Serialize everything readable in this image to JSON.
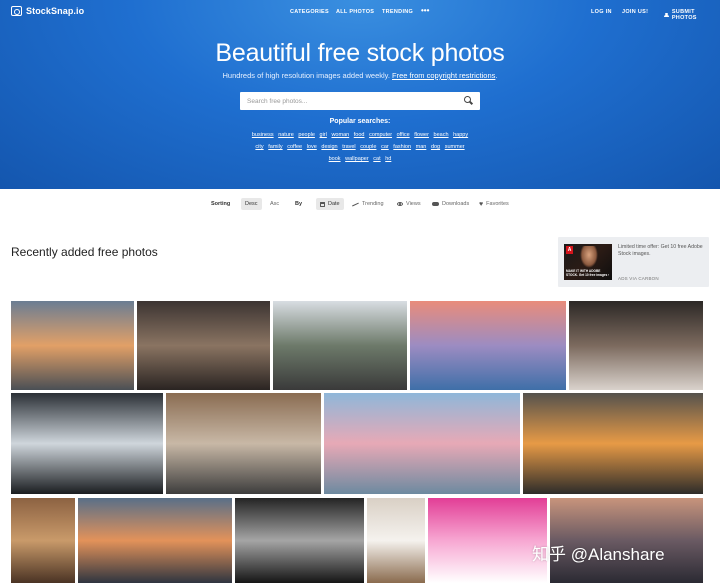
{
  "nav": {
    "logo": "StockSnap.io",
    "categories": "CATEGORIES",
    "all_photos": "ALL PHOTOS",
    "trending": "TRENDING",
    "more": "•••",
    "login": "LOG IN",
    "join": "JOIN US!",
    "submit": "SUBMIT PHOTOS"
  },
  "hero": {
    "title": "Beautiful free stock photos",
    "subtitle_prefix": "Hundreds of high resolution images added weekly. ",
    "subtitle_link": "Free from copyright restrictions",
    "subtitle_suffix": ".",
    "search_placeholder": "Search free photos...",
    "popular_title": "Popular searches:",
    "tags_row1": [
      "business",
      "nature",
      "people",
      "girl",
      "woman",
      "food",
      "computer",
      "office",
      "flower",
      "beach",
      "happy"
    ],
    "tags_row2": [
      "city",
      "family",
      "coffee",
      "love",
      "design",
      "travel",
      "couple",
      "car",
      "fashion",
      "man",
      "dog",
      "summer"
    ],
    "tags_row3": [
      "book",
      "wallpaper",
      "cat",
      "hd"
    ]
  },
  "sorting": {
    "label": "Sorting",
    "desc": "Desc",
    "asc": "Asc",
    "by_label": "By",
    "date": "Date",
    "trending": "Trending",
    "views": "Views",
    "downloads": "Downloads",
    "favorites": "Favorites"
  },
  "section_title": "Recently added free photos",
  "ad": {
    "text": "Limited time offer: Get 10 free Adobe Stock images.",
    "via": "ADS VIA CARBON",
    "image_text": "MAKE IT WITH ADOBE STOCK. Get 10 free images ›"
  },
  "watermark": "知乎 @Alanshare",
  "photos": [
    {
      "name": "photo-sunset-city",
      "colors": [
        "#6b7d93",
        "#e2a067",
        "#4a4f55"
      ]
    },
    {
      "name": "photo-records-man",
      "colors": [
        "#3c3432",
        "#8a7462",
        "#2a2422"
      ]
    },
    {
      "name": "photo-palm-photographer",
      "colors": [
        "#d8dde2",
        "#6d7a6a",
        "#3a3a3a"
      ]
    },
    {
      "name": "photo-pink-sea-sunset",
      "colors": [
        "#e98c7b",
        "#9c8cc2",
        "#3f6fa8"
      ]
    },
    {
      "name": "photo-wine-glasses",
      "colors": [
        "#2c2826",
        "#7c6a5e",
        "#d9d2cc"
      ]
    },
    {
      "name": "photo-crashing-waves",
      "colors": [
        "#2b3036",
        "#cfd6dc",
        "#1a1d20"
      ]
    },
    {
      "name": "photo-staircase-interior",
      "colors": [
        "#8a6c52",
        "#c8b8a6",
        "#3d3d3d"
      ]
    },
    {
      "name": "photo-beach-pink-cloud",
      "colors": [
        "#8fb7d9",
        "#e7a9b6",
        "#6d8aa0"
      ]
    },
    {
      "name": "photo-orange-sky-clouds",
      "colors": [
        "#55524d",
        "#e79a46",
        "#2d2c2a"
      ]
    },
    {
      "name": "photo-canyon-rocks",
      "colors": [
        "#8c6242",
        "#c99a6a",
        "#4a3324"
      ]
    },
    {
      "name": "photo-river-city-dusk",
      "colors": [
        "#596f88",
        "#e3925a",
        "#2f3540"
      ]
    },
    {
      "name": "photo-woman-hat-window",
      "colors": [
        "#242424",
        "#a5a5a5",
        "#151515"
      ]
    },
    {
      "name": "photo-bike-coffee",
      "colors": [
        "#d9d0c5",
        "#f5f2ee",
        "#8a6b4e"
      ]
    },
    {
      "name": "photo-pink-polygons",
      "colors": [
        "#e23e96",
        "#f7a7d2",
        "#ffffff"
      ]
    },
    {
      "name": "photo-palm-sunset",
      "colors": [
        "#c8947c",
        "#6a5a63",
        "#2b2a33"
      ]
    }
  ]
}
